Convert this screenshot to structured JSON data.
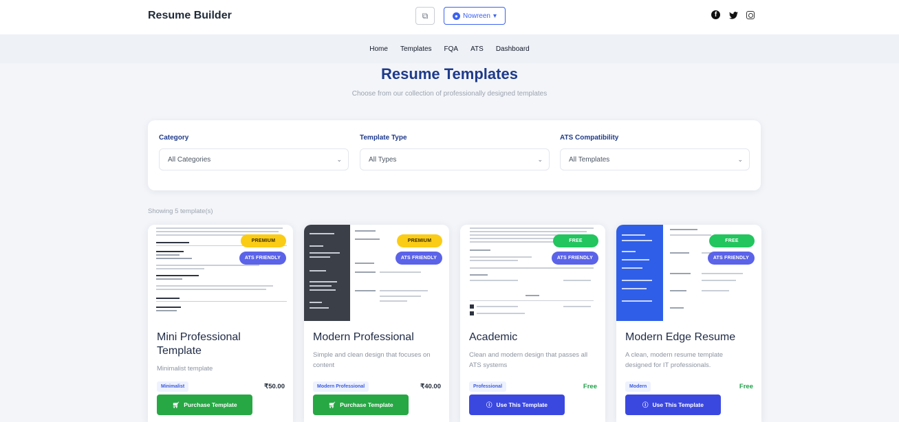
{
  "header": {
    "brand": "Resume Builder",
    "copy_icon": "copy-icon",
    "user_label": "Nowreen",
    "user_icon": "user-icon",
    "socials": [
      "facebook-icon",
      "twitter-icon",
      "instagram-icon"
    ]
  },
  "nav": [
    "Home",
    "Templates",
    "FQA",
    "ATS",
    "Dashboard"
  ],
  "hero": {
    "title": "Resume Templates",
    "subtitle": "Choose from our collection of professionally designed templates"
  },
  "filters": [
    {
      "label": "Category",
      "value": "All Categories"
    },
    {
      "label": "Template Type",
      "value": "All Types"
    },
    {
      "label": "ATS Compatibility",
      "value": "All Templates"
    }
  ],
  "showing": "Showing 5 template(s)",
  "cards": [
    {
      "title": "Mini Professional Template",
      "desc": "Minimalist template",
      "tag": "Minimalist",
      "price": "₹50.00",
      "tier": "PREMIUM",
      "ats": "ATS FRIENDLY",
      "action": "Purchase Template"
    },
    {
      "title": "Modern Professional",
      "desc": "Simple and clean design that focuses on content",
      "tag": "Modern Professional",
      "price": "₹40.00",
      "tier": "PREMIUM",
      "ats": "ATS FRIENDLY",
      "action": "Purchase Template"
    },
    {
      "title": "Academic",
      "desc": "Clean and modern design that passes all ATS systems",
      "tag": "Professional",
      "price": "Free",
      "tier": "FREE",
      "ats": "ATS FRIENDLY",
      "action": "Use This Template"
    },
    {
      "title": "Modern Edge Resume",
      "desc": "A clean, modern resume template designed for IT professionals.",
      "tag": "Modern",
      "price": "Free",
      "tier": "FREE",
      "ats": "ATS FRIENDLY",
      "action": "Use This Template"
    }
  ],
  "colors": {
    "primary": "#1e3a8a",
    "accent_blue": "#3b48e0",
    "green": "#28a745",
    "premium_yellow": "#facc15",
    "ats_purple": "#5b63e8"
  }
}
